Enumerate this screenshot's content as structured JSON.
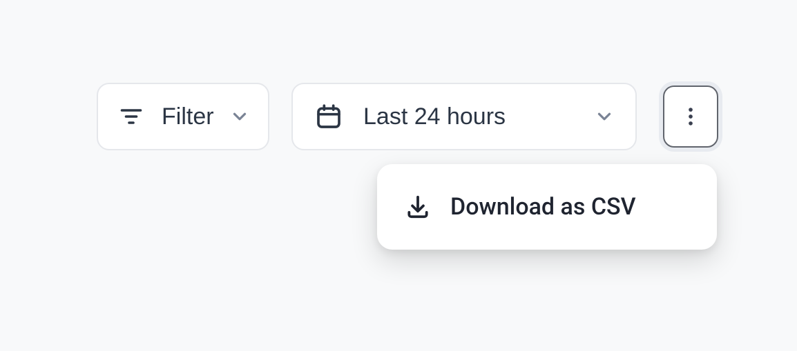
{
  "toolbar": {
    "filter_label": "Filter",
    "date_range_label": "Last 24 hours"
  },
  "menu": {
    "download_csv_label": "Download as CSV"
  }
}
